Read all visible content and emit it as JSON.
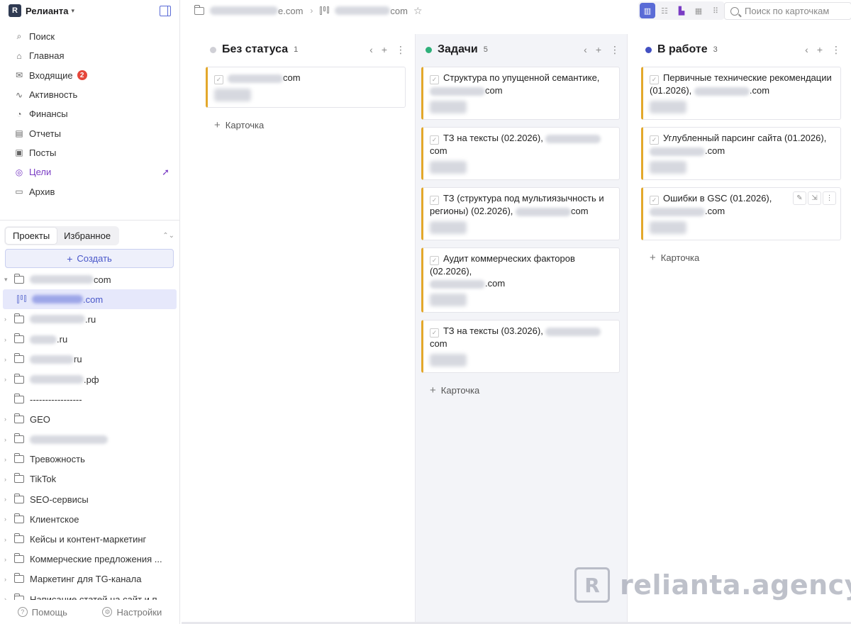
{
  "workspace": {
    "name": "Релианта",
    "logo_letter": "R"
  },
  "nav": {
    "items": [
      {
        "label": "Поиск",
        "icon": "search-icon"
      },
      {
        "label": "Главная",
        "icon": "home-icon"
      },
      {
        "label": "Входящие",
        "icon": "inbox-icon",
        "badge": "2"
      },
      {
        "label": "Активность",
        "icon": "activity-icon"
      },
      {
        "label": "Финансы",
        "icon": "finance-icon"
      },
      {
        "label": "Отчеты",
        "icon": "report-icon"
      },
      {
        "label": "Посты",
        "icon": "posts-icon"
      },
      {
        "label": "Цели",
        "icon": "target-icon",
        "active": true
      },
      {
        "label": "Архив",
        "icon": "archive-icon"
      }
    ]
  },
  "projects": {
    "tabs": [
      "Проекты",
      "Избранное"
    ],
    "create_label": "Создать",
    "tree": [
      {
        "suffix": "com",
        "caret": "▾"
      },
      {
        "suffix": ".com",
        "board": true
      },
      {
        "suffix": ".ru",
        "caret": "›"
      },
      {
        "suffix": ".ru",
        "caret": "›"
      },
      {
        "suffix": "ru",
        "caret": "›"
      },
      {
        "suffix": ".рф",
        "caret": "›"
      },
      {
        "label": "-----------------",
        "caret": ""
      },
      {
        "label": "GEO",
        "caret": "›"
      },
      {
        "label": "",
        "caret": "›"
      },
      {
        "label": "Тревожность",
        "caret": "›"
      },
      {
        "label": "TikTok",
        "caret": "›"
      },
      {
        "label": "SEO-сервисы",
        "caret": "›"
      },
      {
        "label": "Клиентское",
        "caret": "›"
      },
      {
        "label": "Кейсы и контент-маркетинг",
        "caret": "›"
      },
      {
        "label": "Коммерческие предложения ...",
        "caret": "›"
      },
      {
        "label": "Маркетинг для TG-канала",
        "caret": "›"
      },
      {
        "label": "Написание статей на сайт и п...",
        "caret": "›"
      }
    ]
  },
  "footer": {
    "help": "Помощь",
    "settings": "Настройки"
  },
  "breadcrumb": {
    "project_suffix": "e.com",
    "board_suffix": "com"
  },
  "search": {
    "placeholder": "Поиск по карточкам"
  },
  "board": {
    "add_card_label": "Карточка",
    "columns": [
      {
        "title": "Без статуса",
        "count": "1",
        "color": "#d0d0d6",
        "cards": [
          {
            "text": "com"
          }
        ]
      },
      {
        "title": "Задачи",
        "count": "5",
        "color": "#2eb07a",
        "cards": [
          {
            "text": "Структура по упущенной семантике,",
            "tail": "com"
          },
          {
            "text": "ТЗ на тексты (02.2026),",
            "tail_inline": "com"
          },
          {
            "text": "ТЗ (структура под мультиязычность и регионы) (02.2026),",
            "tail_inline": "com"
          },
          {
            "text": "Аудит коммерческих факторов (02.2026),",
            "tail": ".com"
          },
          {
            "text": "ТЗ на тексты (03.2026),",
            "tail_inline": "com"
          }
        ]
      },
      {
        "title": "В работе",
        "count": "3",
        "color": "#4350c2",
        "cards": [
          {
            "text": "Первичные технические рекомендации (01.2026),",
            "tail_inline": ".com"
          },
          {
            "text": "Углубленный парсинг сайта (01.2026),",
            "tail": ".com"
          },
          {
            "text": "Ошибки в GSC (01.2026),",
            "tail": ".com",
            "tools": true
          }
        ]
      }
    ]
  },
  "watermark": {
    "text": "relianta.agency"
  },
  "colors": {
    "accent": "#5a6bd6",
    "card_border": "#e3a82b",
    "goal_active": "#7a3cc4"
  }
}
